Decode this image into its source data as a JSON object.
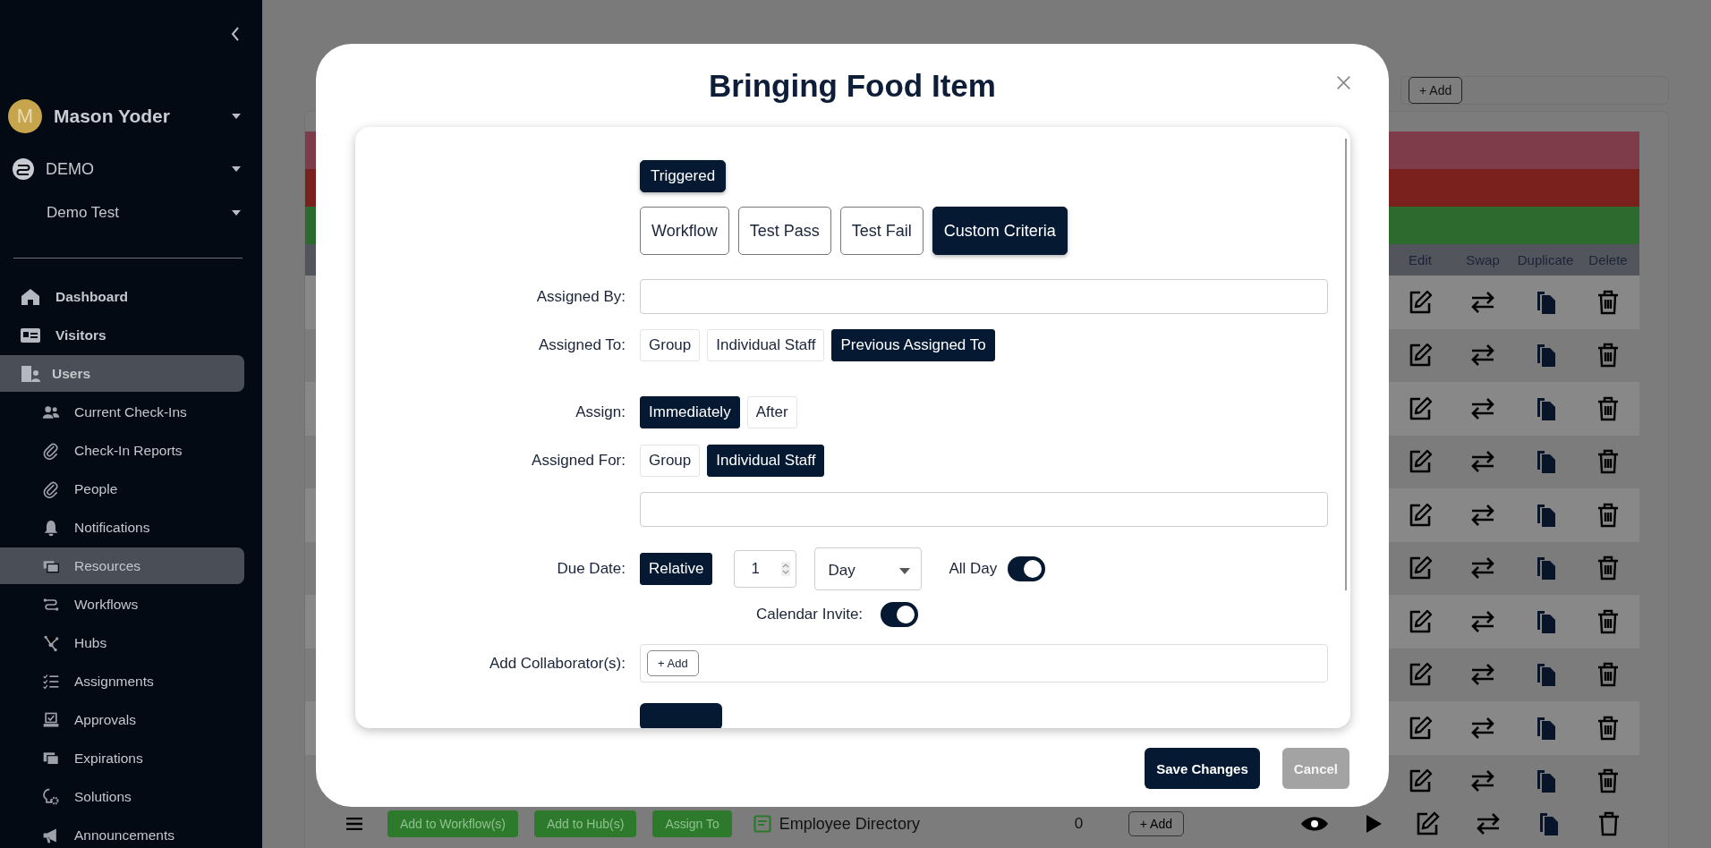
{
  "sidebar": {
    "user": {
      "initial": "M",
      "name": "Mason Yoder"
    },
    "organization": "DEMO",
    "location": "Demo Test",
    "nav": [
      {
        "label": "Dashboard",
        "kind": "main",
        "selected": false
      },
      {
        "label": "Visitors",
        "kind": "main",
        "selected": false
      },
      {
        "label": "Users",
        "kind": "main",
        "selected": true
      },
      {
        "label": "Current Check-Ins",
        "kind": "sub",
        "selected": false
      },
      {
        "label": "Check-In Reports",
        "kind": "sub",
        "selected": false
      },
      {
        "label": "People",
        "kind": "sub",
        "selected": false
      },
      {
        "label": "Notifications",
        "kind": "sub",
        "selected": false
      },
      {
        "label": "Resources",
        "kind": "sub",
        "selected": true
      },
      {
        "label": "Workflows",
        "kind": "sub",
        "selected": false
      },
      {
        "label": "Hubs",
        "kind": "sub",
        "selected": false
      },
      {
        "label": "Assignments",
        "kind": "sub",
        "selected": false
      },
      {
        "label": "Approvals",
        "kind": "sub",
        "selected": false
      },
      {
        "label": "Expirations",
        "kind": "sub",
        "selected": false
      },
      {
        "label": "Solutions",
        "kind": "sub",
        "selected": false
      },
      {
        "label": "Announcements",
        "kind": "sub",
        "selected": false
      }
    ]
  },
  "page": {
    "add_button": "+ Add",
    "banners": [
      {
        "color": "#7e3b4a"
      },
      {
        "color": "#7a201d"
      },
      {
        "color": "#2d6a2d"
      }
    ],
    "table": {
      "columns": [
        "Edit",
        "Swap",
        "Duplicate",
        "Delete"
      ],
      "rows": [
        {
          "shaded": true
        },
        {
          "shaded": false
        },
        {
          "shaded": true
        },
        {
          "shaded": false
        },
        {
          "shaded": true
        },
        {
          "shaded": false
        },
        {
          "shaded": true
        },
        {
          "shaded": false
        },
        {
          "shaded": true
        },
        {
          "shaded": false
        }
      ],
      "last_row": {
        "buttons": [
          "Add to Workflow(s)",
          "Add to Hub(s)",
          "Assign To"
        ],
        "name": "Employee Directory",
        "count": "0",
        "add": "+ Add"
      }
    }
  },
  "modal": {
    "title": "Bringing Food Item",
    "mode": {
      "label": "Triggered",
      "selected": true
    },
    "trigger_types": [
      {
        "label": "Workflow",
        "selected": false
      },
      {
        "label": "Test Pass",
        "selected": false
      },
      {
        "label": "Test Fail",
        "selected": false
      },
      {
        "label": "Custom Criteria",
        "selected": true
      }
    ],
    "assigned_by": {
      "label": "Assigned By:"
    },
    "assigned_to": {
      "label": "Assigned To:",
      "options": [
        {
          "label": "Group",
          "selected": false
        },
        {
          "label": "Individual Staff",
          "selected": false
        },
        {
          "label": "Previous Assigned To",
          "selected": true
        }
      ]
    },
    "assign": {
      "label": "Assign:",
      "options": [
        {
          "label": "Immediately",
          "selected": true
        },
        {
          "label": "After",
          "selected": false
        }
      ]
    },
    "assigned_for": {
      "label": "Assigned For:",
      "options": [
        {
          "label": "Group",
          "selected": false
        },
        {
          "label": "Individual Staff",
          "selected": true
        }
      ]
    },
    "due_date": {
      "label": "Due Date:",
      "mode": {
        "label": "Relative",
        "selected": true
      },
      "amount": "1",
      "unit": "Day",
      "all_day": {
        "label": "All Day",
        "on": true
      }
    },
    "calendar_invite": {
      "label": "Calendar Invite:",
      "on": true
    },
    "collaborators": {
      "label": "Add Collaborator(s):",
      "add": "+ Add"
    },
    "buttons": [
      {
        "label": "Save Changes",
        "kind": "primary"
      },
      {
        "label": "Cancel",
        "kind": "secondary"
      }
    ]
  }
}
